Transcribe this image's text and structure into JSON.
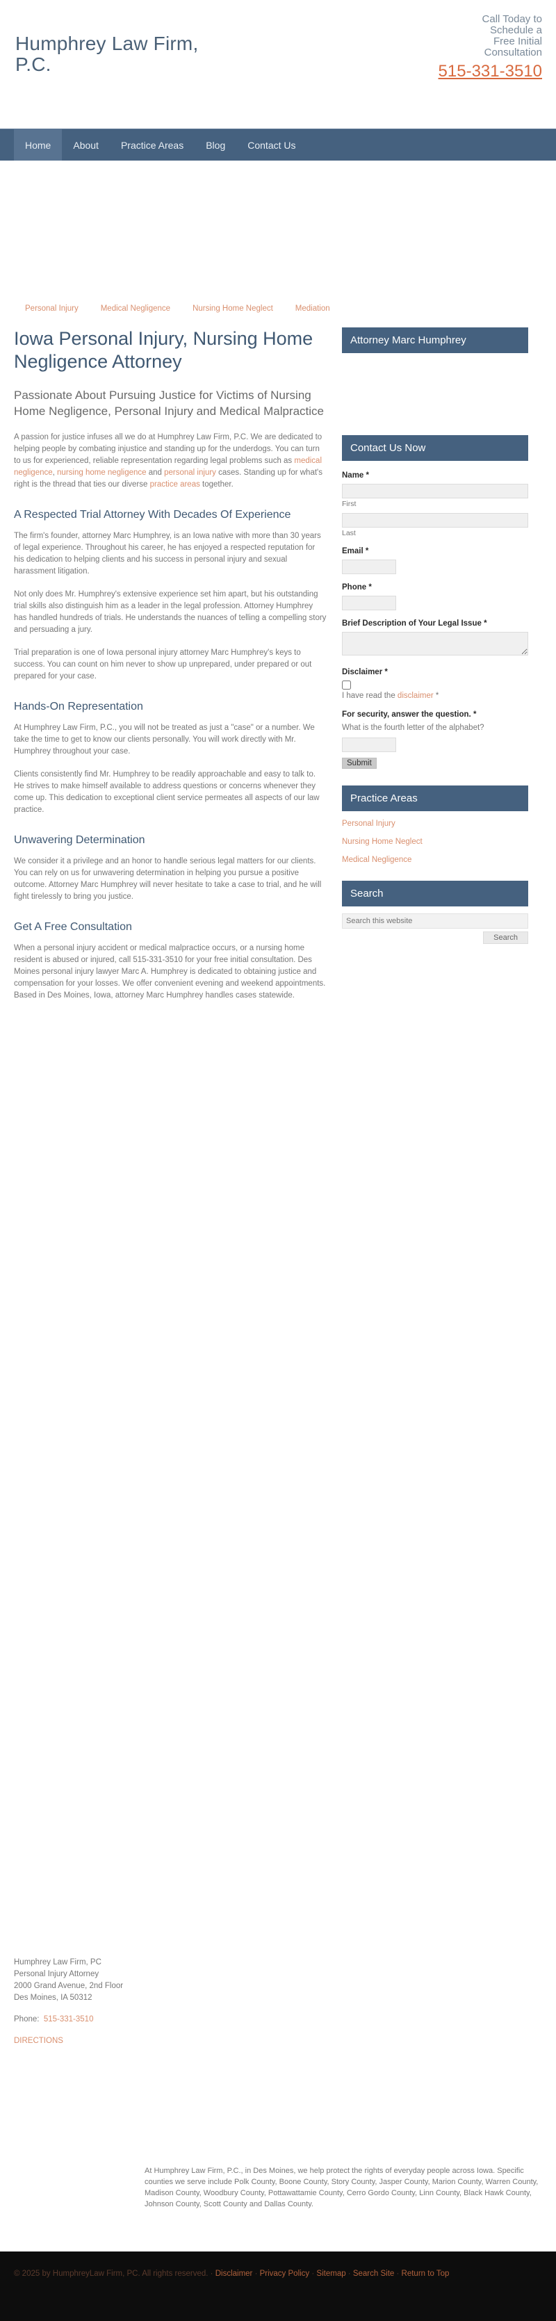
{
  "header": {
    "logo_line1": "Humphrey Law Firm,",
    "logo_line2": "P.C.",
    "call_line1": "Call Today to",
    "call_line2": "Schedule a",
    "call_line3": "Free Initial",
    "call_line4": "Consultation",
    "phone": "515-331-3510",
    "accent_color": "#d86a3f",
    "brand_color": "#45617f"
  },
  "nav": {
    "items": [
      {
        "label": "Home",
        "active": true
      },
      {
        "label": "About",
        "active": false
      },
      {
        "label": "Practice Areas",
        "active": false
      },
      {
        "label": "Blog",
        "active": false
      },
      {
        "label": "Contact Us",
        "active": false
      }
    ]
  },
  "quick_links": [
    {
      "label": "Personal Injury"
    },
    {
      "label": "Medical Negligence"
    },
    {
      "label": "Nursing Home Neglect"
    },
    {
      "label": "Mediation"
    }
  ],
  "main": {
    "title": "Iowa Personal Injury, Nursing Home Negligence Attorney",
    "subtitle": "Passionate About Pursuing Justice for Victims of Nursing Home Negligence, Personal Injury and Medical Malpractice",
    "intro_p1_a": "A passion for justice infuses all we do at Humphrey Law Firm, P.C. We are dedicated to helping people by combating injustice and standing up for the underdogs. You can turn to us for experienced, reliable representation regarding legal problems such as ",
    "intro_link1": "medical negligence",
    "intro_p1_b": ", ",
    "intro_link2": "nursing home negligence",
    "intro_p1_c": " and ",
    "intro_link3": "personal injury",
    "intro_p1_d": " cases. Standing up for what's right is the thread that ties our diverse ",
    "intro_link4": "practice areas",
    "intro_p1_e": " together.",
    "sections": [
      {
        "heading": "A Respected Trial Attorney With Decades Of Experience",
        "paragraphs": [
          "The firm's founder, attorney Marc Humphrey, is an Iowa native with more than 30 years of legal experience. Throughout his career, he has enjoyed a respected reputation for his dedication to helping clients and his success in personal injury and sexual harassment litigation.",
          "Not only does Mr. Humphrey's extensive experience set him apart, but his outstanding trial skills also distinguish him as a leader in the legal profession. Attorney Humphrey has handled hundreds of trials. He understands the nuances of telling a compelling story and persuading a jury.",
          "Trial preparation is one of Iowa personal injury attorney Marc Humphrey's keys to success. You can count on him never to show up unprepared, under prepared or out prepared for your case."
        ],
        "bold_phrase": "hundreds of trials."
      },
      {
        "heading": "Hands-On Representation",
        "paragraphs": [
          "At Humphrey Law Firm, P.C., you will not be treated as just a \"case\" or a number. We take the time to get to know our clients personally. You will work directly with Mr. Humphrey throughout your case.",
          "Clients consistently find Mr. Humphrey to be readily approachable and easy to talk to. He strives to make himself available to address questions or concerns whenever they come up. This dedication to exceptional client service permeates all aspects of our law practice."
        ],
        "link_phrase": "Humphrey Law Firm, P.C."
      },
      {
        "heading": "Unwavering Determination",
        "paragraphs": [
          "We consider it a privilege and an honor to handle serious legal matters for our clients. You can rely on us for unwavering determination in helping you pursue a positive outcome. Attorney Marc Humphrey will never hesitate to take a case to trial, and he will fight tirelessly to bring you justice."
        ]
      },
      {
        "heading": "Get A Free Consultation",
        "paragraphs": [
          "When a personal injury accident or medical malpractice occurs, or a nursing home resident is abused or injured, call 515-331-3510 for your free initial consultation. Des Moines personal injury lawyer Marc A. Humphrey is dedicated to obtaining justice and compensation for your losses.  We offer convenient evening and weekend appointments. Based in Des Moines, Iowa, attorney Marc Humphrey handles cases statewide."
        ],
        "link_phrase": "free initial consultation."
      }
    ]
  },
  "sidebar": {
    "attorney_widget_title": "Attorney Marc Humphrey",
    "contact_widget_title": "Contact Us Now",
    "form": {
      "name_label": "Name *",
      "first_sublabel": "First",
      "last_sublabel": "Last",
      "email_label": "Email *",
      "phone_label": "Phone *",
      "brief_label": "Brief Description of Your Legal Issue *",
      "disclaimer_label": "Disclaimer *",
      "disclaimer_text_a": "I have read the ",
      "disclaimer_link": "disclaimer",
      "disclaimer_text_b": " *",
      "security_label": "For security, answer the question. *",
      "security_question": "What is the fourth letter of the alphabet?",
      "submit_label": "Submit"
    },
    "practice_widget_title": "Practice Areas",
    "practice_items": [
      {
        "label": "Personal Injury"
      },
      {
        "label": "Nursing Home Neglect"
      },
      {
        "label": "Medical Negligence"
      }
    ],
    "search_widget_title": "Search",
    "search_placeholder": "Search this website",
    "search_button": "Search"
  },
  "footer": {
    "firm_name": "Humphrey Law Firm, PC",
    "tagline": "Personal Injury Attorney",
    "address1": "2000 Grand Avenue, 2nd Floor",
    "address2": "Des Moines, IA 50312",
    "phone_label": "Phone:",
    "phone": "515-331-3510",
    "directions": "DIRECTIONS",
    "blurb": "At Humphrey Law Firm, P.C., in Des Moines, we help protect the rights of everyday people across Iowa. Specific counties we serve include Polk County, Boone County, Story County, Jasper County, Marion County, Warren County, Madison County, Woodbury County, Pottawattamie County, Cerro Gordo County, Linn County, Black Hawk County, Johnson County, Scott County and Dallas County.",
    "copyright": "© 2025 by HumphreyLaw Firm, PC. All rights reserved.",
    "links": [
      {
        "label": "Disclaimer"
      },
      {
        "label": "Privacy Policy"
      },
      {
        "label": "Sitemap"
      },
      {
        "label": "Search Site"
      },
      {
        "label": "Return to Top"
      }
    ]
  }
}
